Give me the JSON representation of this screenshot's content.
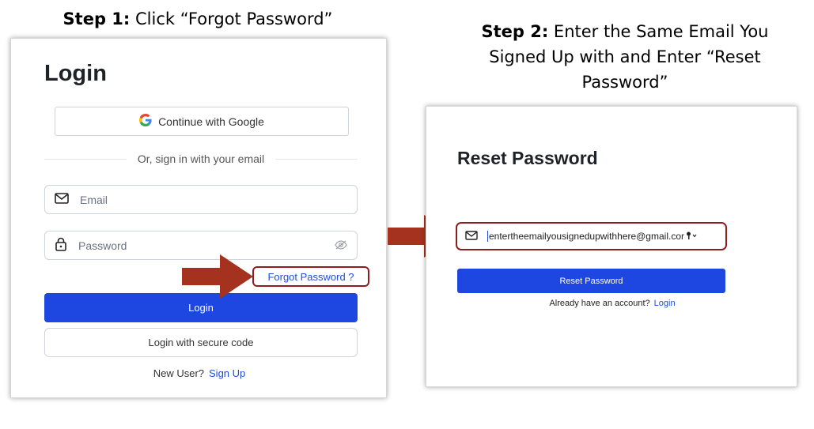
{
  "step1": {
    "label": "Step 1:",
    "text": " Click “Forgot Password”"
  },
  "step2": {
    "label": "Step 2:",
    "text": " Enter the Same Email You Signed Up with and Enter “Reset Password”"
  },
  "login": {
    "title": "Login",
    "google_button": "Continue with Google",
    "divider_text": "Or, sign in with your email",
    "email_placeholder": "Email",
    "password_placeholder": "Password",
    "forgot_link": "Forgot Password ?",
    "login_button": "Login",
    "secure_code_button": "Login with secure code",
    "new_user_text": "New User?",
    "signup_link": "Sign Up"
  },
  "reset": {
    "title": "Reset Password",
    "email_value": "entertheemailyousignedupwithhere@gmail.cor",
    "reset_button": "Reset Password",
    "account_text": "Already have an account?",
    "login_link": "Login"
  },
  "colors": {
    "primary": "#1e46e0",
    "link": "#1d4ed8",
    "highlight": "#8b1f1f",
    "arrow": "#a5321e"
  },
  "icons": [
    "google-icon",
    "mail-icon",
    "lock-icon",
    "eye-off-icon",
    "key-icon",
    "arrow-right-icon"
  ]
}
